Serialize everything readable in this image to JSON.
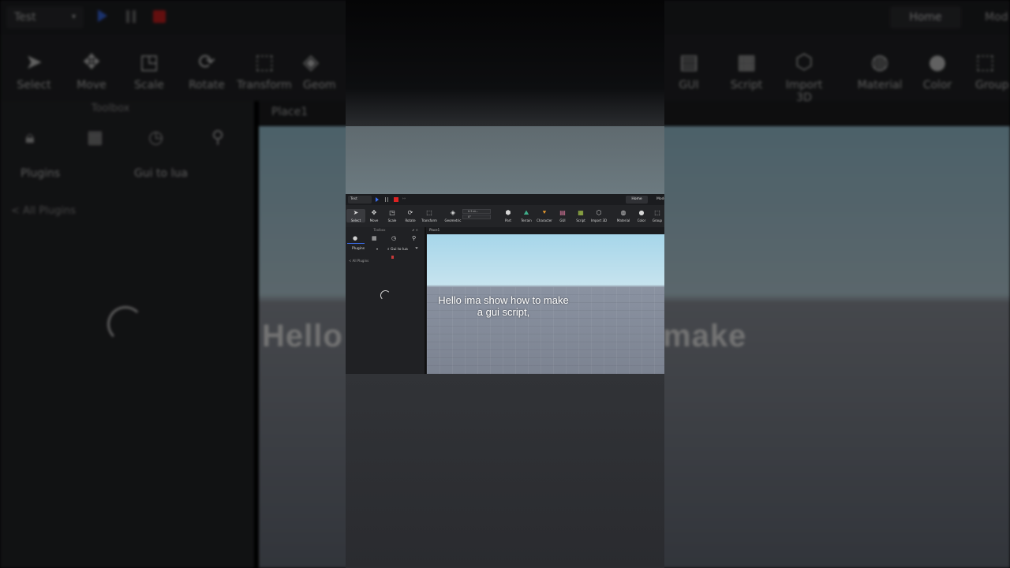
{
  "background": {
    "project": "Test",
    "tabs": {
      "home": "Home",
      "model": "Mod"
    },
    "tools": [
      "Select",
      "Move",
      "Scale",
      "Rotate",
      "Transform",
      "Geom",
      "GUI",
      "Script",
      "Import 3D",
      "Material",
      "Color",
      "Group"
    ],
    "panel_title": "Toolbox",
    "plugins_label": "Plugins",
    "search_text": "Gui to lua",
    "all_plugins": "< All Plugins",
    "view_tab": "Place1",
    "caption_left": "Hello",
    "caption_right": "make"
  },
  "studio": {
    "project": "Test",
    "tabs": {
      "home": "Home",
      "model": "Model"
    },
    "tools": [
      {
        "label": "Select",
        "icon": "cursor-icon"
      },
      {
        "label": "Move",
        "icon": "move-icon"
      },
      {
        "label": "Scale",
        "icon": "scale-icon"
      },
      {
        "label": "Rotate",
        "icon": "rotate-icon"
      },
      {
        "label": "Transform",
        "icon": "transform-icon"
      },
      {
        "label": "Geometric",
        "icon": "geometric-icon"
      },
      {
        "label": "Part",
        "icon": "part-icon"
      },
      {
        "label": "Terrain",
        "icon": "terrain-icon"
      },
      {
        "label": "Character",
        "icon": "character-icon"
      },
      {
        "label": "GUI",
        "icon": "gui-icon"
      },
      {
        "label": "Script",
        "icon": "script-icon"
      },
      {
        "label": "Import 3D",
        "icon": "import-icon"
      },
      {
        "label": "Material",
        "icon": "material-icon"
      },
      {
        "label": "Color",
        "icon": "color-icon"
      },
      {
        "label": "Group",
        "icon": "group-icon"
      }
    ],
    "move_increment": "0.5 st...",
    "rotate_increment": "0°",
    "panel_title": "Toolbox",
    "plugins_label": "Plugins",
    "search_text": "Gui to lua",
    "all_plugins": "< All Plugins",
    "view_tab": "Place1",
    "caption_line1": "Hello ima show how to make",
    "caption_line2": "a gui script,"
  }
}
